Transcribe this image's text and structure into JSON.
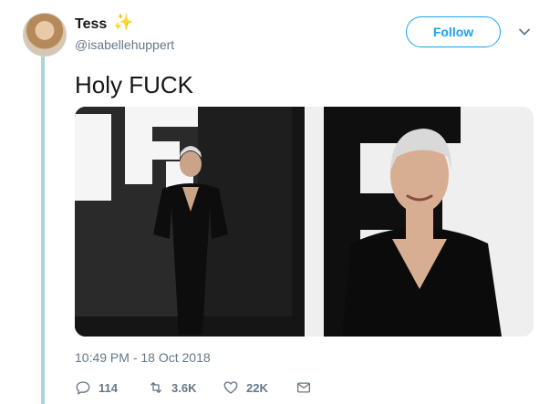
{
  "user": {
    "name": "Tess",
    "emoji": "✨",
    "handle": "@isabellehuppert"
  },
  "follow_label": "Follow",
  "tweet": {
    "text": "Holy FUCK",
    "timestamp": "10:49 PM - 18 Oct 2018"
  },
  "actions": {
    "replies": "114",
    "retweets": "3.6K",
    "likes": "22K"
  },
  "colors": {
    "accent": "#1da1f2",
    "muted": "#657786",
    "thread_line": "#a8d6dc"
  },
  "icons": [
    "reply-icon",
    "retweet-icon",
    "like-icon",
    "message-icon",
    "chevron-down-icon",
    "sparkles-icon"
  ]
}
